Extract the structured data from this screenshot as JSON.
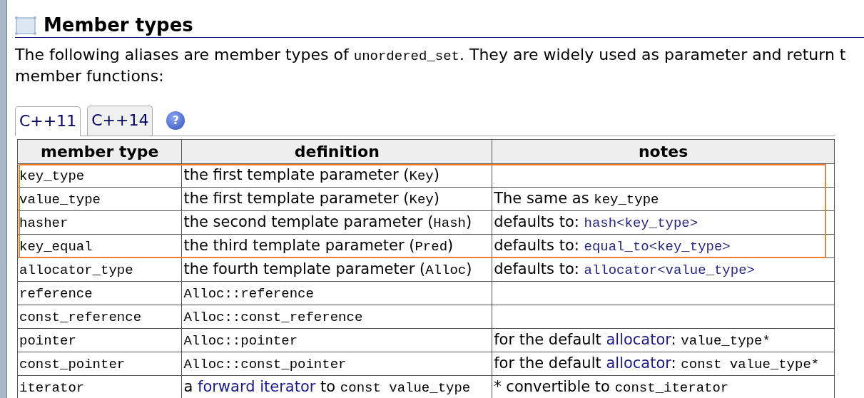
{
  "section": {
    "title": "Member types"
  },
  "intro": {
    "lines": [
      [
        {
          "kind": "text",
          "text": "The following aliases are member types of "
        },
        {
          "kind": "code",
          "text": "unordered_set"
        },
        {
          "kind": "text",
          "text": ". They are widely used as parameter and return t"
        }
      ],
      [
        {
          "kind": "text",
          "text": "member functions:"
        }
      ]
    ]
  },
  "tabs": [
    {
      "label": "C++11",
      "selected": true
    },
    {
      "label": "C++14",
      "selected": false
    }
  ],
  "help": "?",
  "table": {
    "columns": [
      "member type",
      "definition",
      "notes"
    ],
    "rows": [
      {
        "highlighted": true,
        "cells": [
          [
            {
              "kind": "code",
              "text": "key_type"
            }
          ],
          [
            {
              "kind": "text",
              "text": "the first template parameter ("
            },
            {
              "kind": "code",
              "text": "Key"
            },
            {
              "kind": "text",
              "text": ")"
            }
          ],
          []
        ]
      },
      {
        "highlighted": true,
        "cells": [
          [
            {
              "kind": "code",
              "text": "value_type"
            }
          ],
          [
            {
              "kind": "text",
              "text": "the first template parameter ("
            },
            {
              "kind": "code",
              "text": "Key"
            },
            {
              "kind": "text",
              "text": ")"
            }
          ],
          [
            {
              "kind": "text",
              "text": "The same as "
            },
            {
              "kind": "code",
              "text": "key_type"
            }
          ]
        ]
      },
      {
        "highlighted": true,
        "cells": [
          [
            {
              "kind": "code",
              "text": "hasher"
            }
          ],
          [
            {
              "kind": "text",
              "text": "the second template parameter ("
            },
            {
              "kind": "code",
              "text": "Hash"
            },
            {
              "kind": "text",
              "text": ")"
            }
          ],
          [
            {
              "kind": "text",
              "text": "defaults to: "
            },
            {
              "kind": "code-link",
              "text": "hash<key_type>"
            }
          ]
        ]
      },
      {
        "highlighted": true,
        "cells": [
          [
            {
              "kind": "code",
              "text": "key_equal"
            }
          ],
          [
            {
              "kind": "text",
              "text": "the third template parameter ("
            },
            {
              "kind": "code",
              "text": "Pred"
            },
            {
              "kind": "text",
              "text": ")"
            }
          ],
          [
            {
              "kind": "text",
              "text": "defaults to: "
            },
            {
              "kind": "code-link",
              "text": "equal_to<key_type>"
            }
          ]
        ]
      },
      {
        "highlighted": false,
        "cells": [
          [
            {
              "kind": "code",
              "text": "allocator_type"
            }
          ],
          [
            {
              "kind": "text",
              "text": "the fourth template parameter ("
            },
            {
              "kind": "code",
              "text": "Alloc"
            },
            {
              "kind": "text",
              "text": ")"
            }
          ],
          [
            {
              "kind": "text",
              "text": "defaults to: "
            },
            {
              "kind": "code-link",
              "text": "allocator<value_type>"
            }
          ]
        ]
      },
      {
        "highlighted": false,
        "cells": [
          [
            {
              "kind": "code",
              "text": "reference"
            }
          ],
          [
            {
              "kind": "code",
              "text": "Alloc::reference"
            }
          ],
          []
        ]
      },
      {
        "highlighted": false,
        "cells": [
          [
            {
              "kind": "code",
              "text": "const_reference"
            }
          ],
          [
            {
              "kind": "code",
              "text": "Alloc::const_reference"
            }
          ],
          []
        ]
      },
      {
        "highlighted": false,
        "cells": [
          [
            {
              "kind": "code",
              "text": "pointer"
            }
          ],
          [
            {
              "kind": "code",
              "text": "Alloc::pointer"
            }
          ],
          [
            {
              "kind": "text",
              "text": "for the default "
            },
            {
              "kind": "link",
              "text": "allocator"
            },
            {
              "kind": "text",
              "text": ": "
            },
            {
              "kind": "code",
              "text": "value_type*"
            }
          ]
        ]
      },
      {
        "highlighted": false,
        "cells": [
          [
            {
              "kind": "code",
              "text": "const_pointer"
            }
          ],
          [
            {
              "kind": "code",
              "text": "Alloc::const_pointer"
            }
          ],
          [
            {
              "kind": "text",
              "text": "for the default "
            },
            {
              "kind": "link",
              "text": "allocator"
            },
            {
              "kind": "text",
              "text": ": "
            },
            {
              "kind": "code",
              "text": "const value_type*"
            }
          ]
        ]
      },
      {
        "highlighted": false,
        "cells": [
          [
            {
              "kind": "code",
              "text": "iterator"
            }
          ],
          [
            {
              "kind": "text",
              "text": "a "
            },
            {
              "kind": "link",
              "text": "forward iterator"
            },
            {
              "kind": "text",
              "text": " to "
            },
            {
              "kind": "code",
              "text": "const value_type"
            }
          ],
          [
            {
              "kind": "text",
              "text": "* convertible to "
            },
            {
              "kind": "code",
              "text": "const_iterator"
            }
          ]
        ]
      }
    ]
  }
}
